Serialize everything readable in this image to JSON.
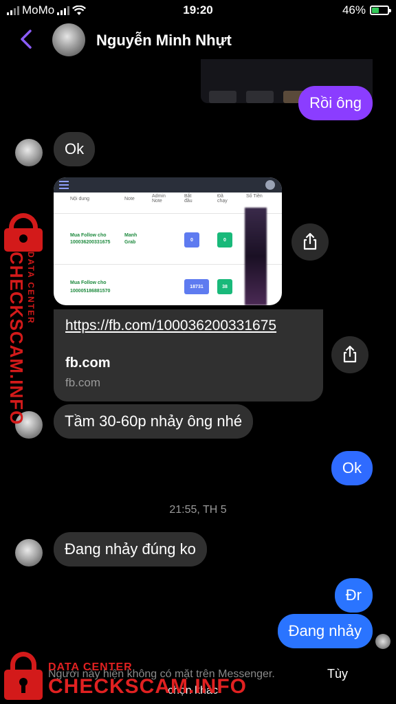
{
  "status_bar": {
    "carrier": "MoMo",
    "time": "19:20",
    "battery": "46%",
    "battery_level": 0.46
  },
  "header": {
    "contact_name": "Nguyễn Minh Nhựt",
    "back_icon": "chevron-left-icon"
  },
  "messages": {
    "m1": "Rồi ông",
    "m2": "Ok",
    "m3": "Tầm 30-60p nhảy ông nhé",
    "m4": "Ok",
    "m5": "Đang nhảy đúng ko",
    "m6": "Đr",
    "m7": "Đang nhảy"
  },
  "image_attachment": {
    "headers": {
      "content": "Nội dung",
      "note": "Note",
      "admin_note": "Admin Note",
      "start": "Bắt đầu",
      "ran": "Đã chạy",
      "amount": "Số Tiền"
    },
    "rows": [
      {
        "content": "Mua Follow cho 100036200331675",
        "note": "Manh Grab",
        "start": "0",
        "ran": "0"
      },
      {
        "content": "Mua Follow cho 100005186881570",
        "note": "",
        "start": "18731",
        "ran": "38"
      }
    ]
  },
  "link_preview": {
    "url": "https://fb.com/100036200331675",
    "title": "fb.com",
    "domain": "fb.com"
  },
  "timestamp": "21:55, TH 5",
  "notice": {
    "text": "Người này hiện không có mặt trên Messenger.",
    "action": "Tùy",
    "more": "chọn khác"
  },
  "watermark": {
    "small": "DATA CENTER",
    "large": "CHECKSCAM.INFO",
    "color": "#e02121"
  },
  "colors": {
    "purple_bubble": "#8b3dff",
    "blue_bubble": "#2f6bff",
    "incoming_bubble": "#303030",
    "accent": "#8b5cf6"
  }
}
